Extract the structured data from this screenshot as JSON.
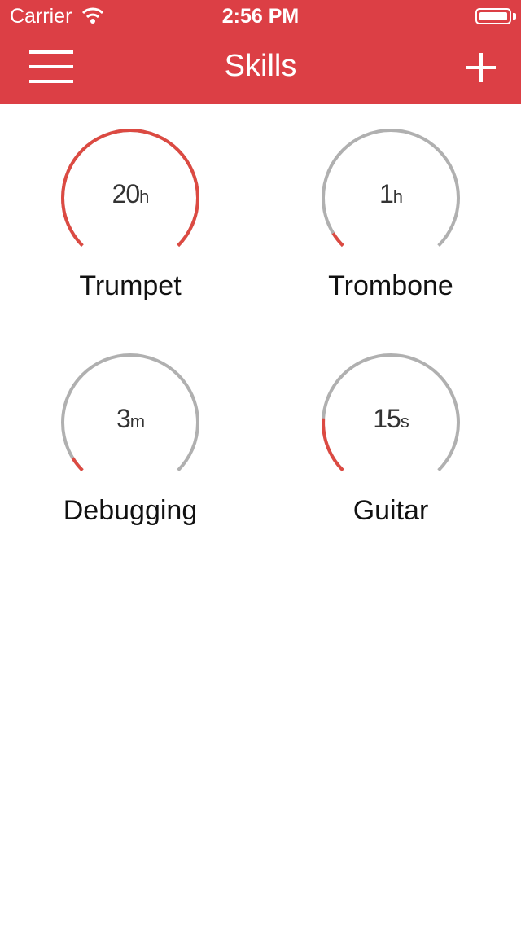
{
  "status_bar": {
    "carrier": "Carrier",
    "time": "2:56 PM"
  },
  "nav": {
    "title": "Skills",
    "menu_icon": "hamburger-icon",
    "add_icon": "plus-icon"
  },
  "colors": {
    "accent": "#dc3f45",
    "track": "#b0b0b0",
    "progress": "#dc4a42"
  },
  "skills": [
    {
      "name": "Trumpet",
      "amount": "20",
      "unit": "h",
      "progress": 1.0
    },
    {
      "name": "Trombone",
      "amount": "1",
      "unit": "h",
      "progress": 0.05
    },
    {
      "name": "Debugging",
      "amount": "3",
      "unit": "m",
      "progress": 0.05
    },
    {
      "name": "Guitar",
      "amount": "15",
      "unit": "s",
      "progress": 0.18
    }
  ]
}
